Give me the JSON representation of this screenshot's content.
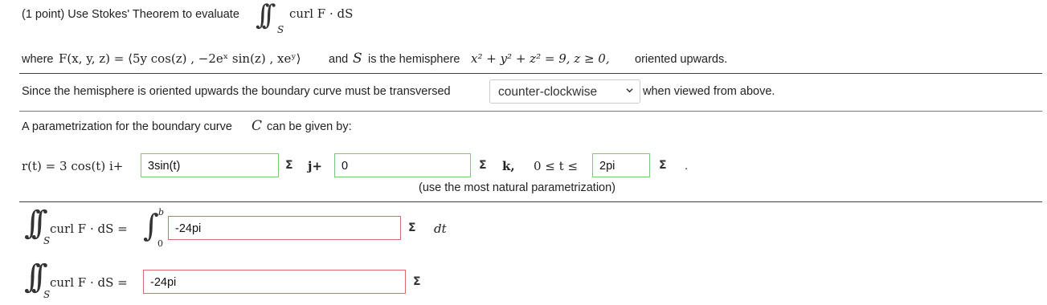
{
  "problem": {
    "intro": "(1 point) Use Stokes' Theorem to evaluate",
    "integrand": "curl F · dS",
    "region": "S",
    "where_prefix": "where",
    "field_expr": "F(x, y, z) = ⟨5y cos(z) , −2eˣ sin(z) , xeʸ⟩",
    "and_text": "and",
    "surface_var": "S",
    "is_text": "is the hemisphere",
    "surface_eq": "x² + y² + z² = 9,  z ≥ 0,",
    "oriented": "oriented upwards."
  },
  "orientation": {
    "before": "Since the hemisphere is oriented upwards the boundary curve must be transversed",
    "selected": "counter-clockwise",
    "after": "when viewed from above."
  },
  "param": {
    "intro": "A parametrization for the boundary curve",
    "curve_var": "C",
    "intro_end": "can be given by:",
    "r_lhs": "r(t) = 3 cos(t) i+",
    "i_component": "3sin(t)",
    "j_unit": "j+",
    "k_component": "0",
    "k_unit": "k,",
    "bounds_lhs": "0 ≤ t ≤",
    "upper_bound": "2pi",
    "end_period": ".",
    "note": "(use the most natural parametrization)"
  },
  "integral1": {
    "lhs": "curl F · dS =",
    "lower": "0",
    "upper": "b",
    "value": "-24pi",
    "dt": "dt"
  },
  "integral2": {
    "lhs": "curl F · dS =",
    "value": "-24pi"
  },
  "sigma_symbol": "Σ",
  "colors": {
    "correct_border": "#7cc97c",
    "incorrect_border": "#e06b6b"
  }
}
